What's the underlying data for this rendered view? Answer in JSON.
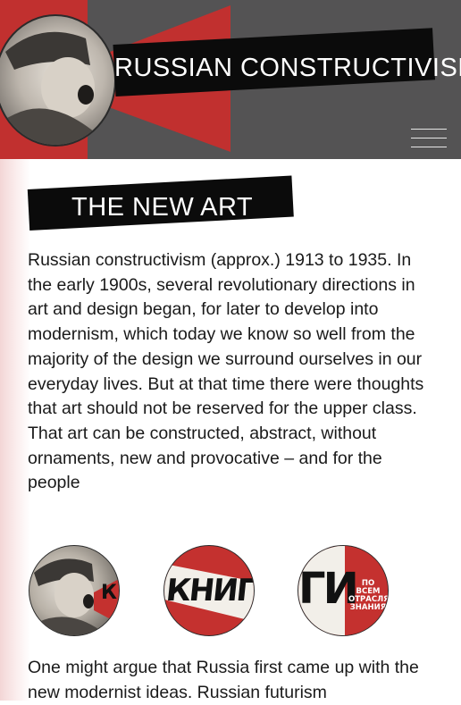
{
  "header": {
    "site_title": "RUSSIAN CONSTRUCTIVISM",
    "menu_icon": "hamburger-menu-icon",
    "colors": {
      "accent_red": "#c1302f",
      "header_gray": "#545354",
      "bar_black": "#0b0b0b"
    }
  },
  "section": {
    "title": "THE NEW ART",
    "paragraph_1": "Russian constructivism (approx.) 1913 to 1935. In the early 1900s, several revolutionary directions in art and design began, for later to develop into modernism, which today we know so well from the majority of the design we surround ourselves in our everyday lives. But at that time there were thoughts that art should not be reserved for the upper class. That art can be constructed, abstract, without ornaments, new and provocative – and for the people",
    "paragraph_2": "One might argue that Russia first came up with the new modernist ideas. Russian futurism"
  },
  "gallery": {
    "items": [
      {
        "poster_text": "КН"
      },
      {
        "poster_text": "КНИГИ"
      },
      {
        "poster_text": "ГИ",
        "poster_subtext": "ПО ВСЕМ ОТРАСЛЯМ ЗНАНИЯ"
      }
    ]
  }
}
